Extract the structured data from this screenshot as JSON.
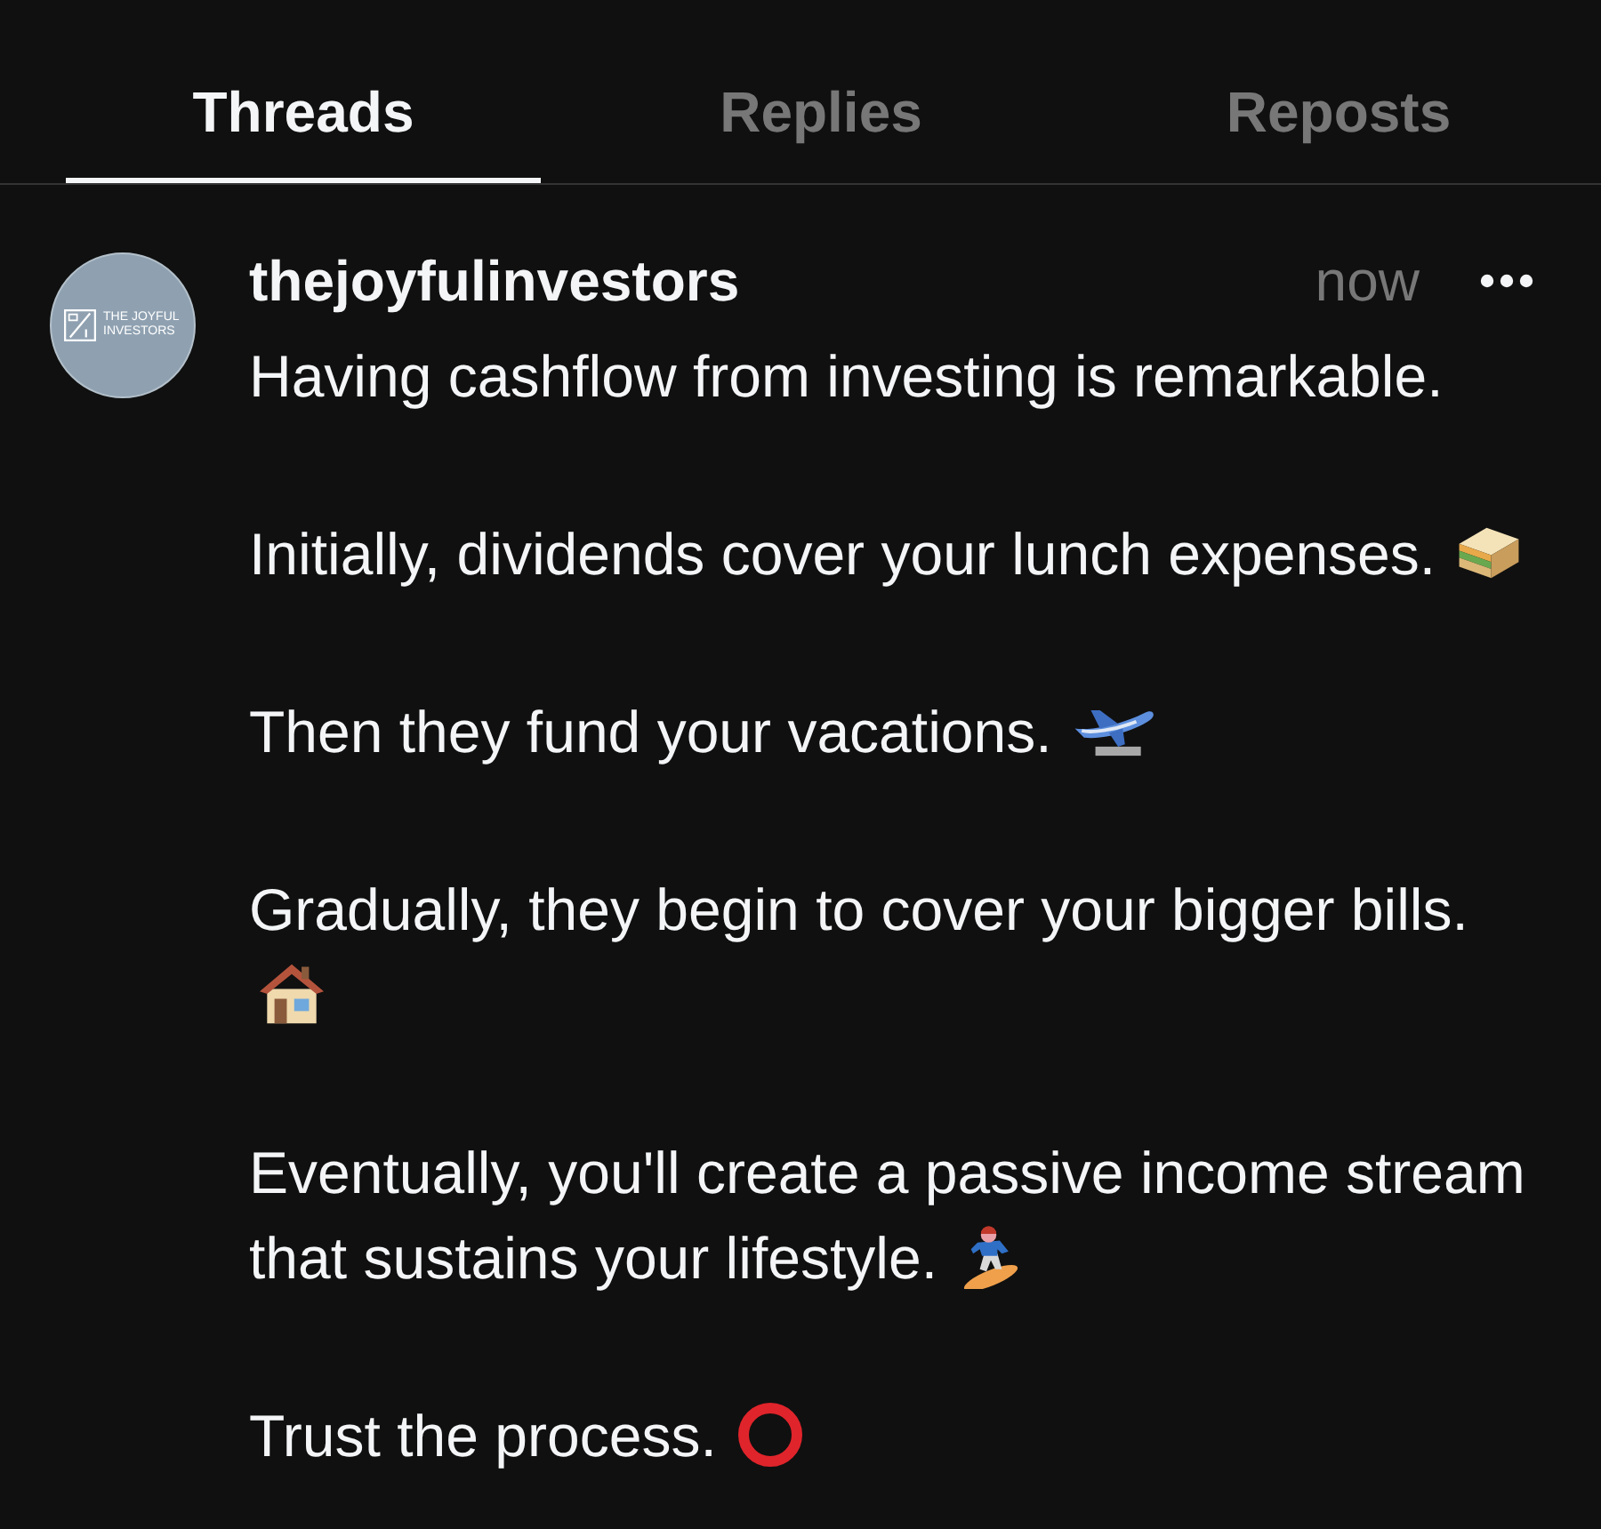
{
  "tabs": [
    {
      "label": "Threads",
      "selected": true
    },
    {
      "label": "Replies",
      "selected": false
    },
    {
      "label": "Reposts",
      "selected": false
    }
  ],
  "post": {
    "avatar": {
      "logo_text": "THE JOYFUL INVESTORS"
    },
    "username": "thejoyfulinvestors",
    "time": "now",
    "paragraphs": [
      {
        "kind": "plain",
        "lines": [
          "Having cashflow from investing is remarkable."
        ]
      },
      {
        "kind": "sandwich",
        "lines": [
          "Initially, dividends cover your lunch expenses."
        ]
      },
      {
        "kind": "airplane",
        "lines": [
          "Then they fund your vacations."
        ]
      },
      {
        "kind": "house",
        "lines": [
          "Gradually, they begin to cover your bigger bills."
        ]
      },
      {
        "kind": "snowboarder",
        "lines": [
          "Eventually, you'll create a passive income stream",
          "that sustains your lifestyle."
        ]
      },
      {
        "kind": "ring",
        "lines": [
          "Trust the process."
        ]
      }
    ]
  }
}
